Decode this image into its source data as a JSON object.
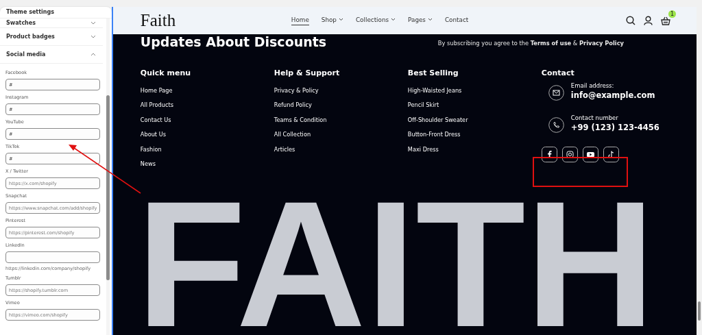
{
  "settings_panel": {
    "title": "Theme settings",
    "sections": [
      {
        "label": "Swatches",
        "expanded": false
      },
      {
        "label": "Product badges",
        "expanded": false
      },
      {
        "label": "Social media",
        "expanded": true
      }
    ],
    "fields": [
      {
        "label": "Facebook",
        "value": "#"
      },
      {
        "label": "Instagram",
        "value": "#"
      },
      {
        "label": "YouTube",
        "value": "#"
      },
      {
        "label": "TikTok",
        "value": "#"
      },
      {
        "label": "X / Twitter",
        "placeholder": "https://x.com/shopify"
      },
      {
        "label": "Snapchat",
        "placeholder": "https://www.snapchat.com/add/shopify"
      },
      {
        "label": "Pinterest",
        "placeholder": "https://pinterest.com/shopify"
      },
      {
        "label": "LinkedIn",
        "hint": "https://linkedin.com/company/shopify"
      },
      {
        "label": "Tumblr",
        "placeholder": "https://shopify.tumblr.com"
      },
      {
        "label": "Vimeo",
        "placeholder": "https://vimeo.com/shopify"
      }
    ]
  },
  "header": {
    "logo": "Faith",
    "nav": [
      {
        "label": "Home",
        "selected": true,
        "dropdown": false
      },
      {
        "label": "Shop",
        "selected": false,
        "dropdown": true
      },
      {
        "label": "Collections",
        "selected": false,
        "dropdown": true
      },
      {
        "label": "Pages",
        "selected": false,
        "dropdown": true
      },
      {
        "label": "Contact",
        "selected": false,
        "dropdown": false
      }
    ],
    "cart_count": "1"
  },
  "footer": {
    "newsletter_heading": "Updates About Discounts",
    "subscribe_note": "By subscribing you agree to the **Terms of use** & **Privacy Policy**",
    "columns": [
      {
        "heading": "Quick menu",
        "links": [
          "Home Page",
          "All Products",
          "Contact Us",
          "About Us",
          "Fashion",
          "News"
        ]
      },
      {
        "heading": "Help & Support",
        "links": [
          "Privacy & Policy",
          "Refund Policy",
          "Teams & Condition",
          "All Collection",
          "Articles"
        ]
      },
      {
        "heading": "Best Selling",
        "links": [
          "High-Waisted Jeans",
          "Pencil Skirt",
          "Off-Shoulder Sweater",
          "Button-Front Dress",
          "Maxi Dress"
        ]
      }
    ],
    "contact": {
      "heading": "Contact",
      "items": [
        {
          "kind": "email",
          "label": "Email address:",
          "value": "info@example.com"
        },
        {
          "kind": "phone",
          "label": "Contact number",
          "value": "+99 (123) 123-4456"
        }
      ],
      "social": [
        {
          "kind": "facebook"
        },
        {
          "kind": "instagram"
        },
        {
          "kind": "youtube"
        },
        {
          "kind": "tiktok"
        }
      ]
    },
    "brand_text": "FAITH"
  }
}
